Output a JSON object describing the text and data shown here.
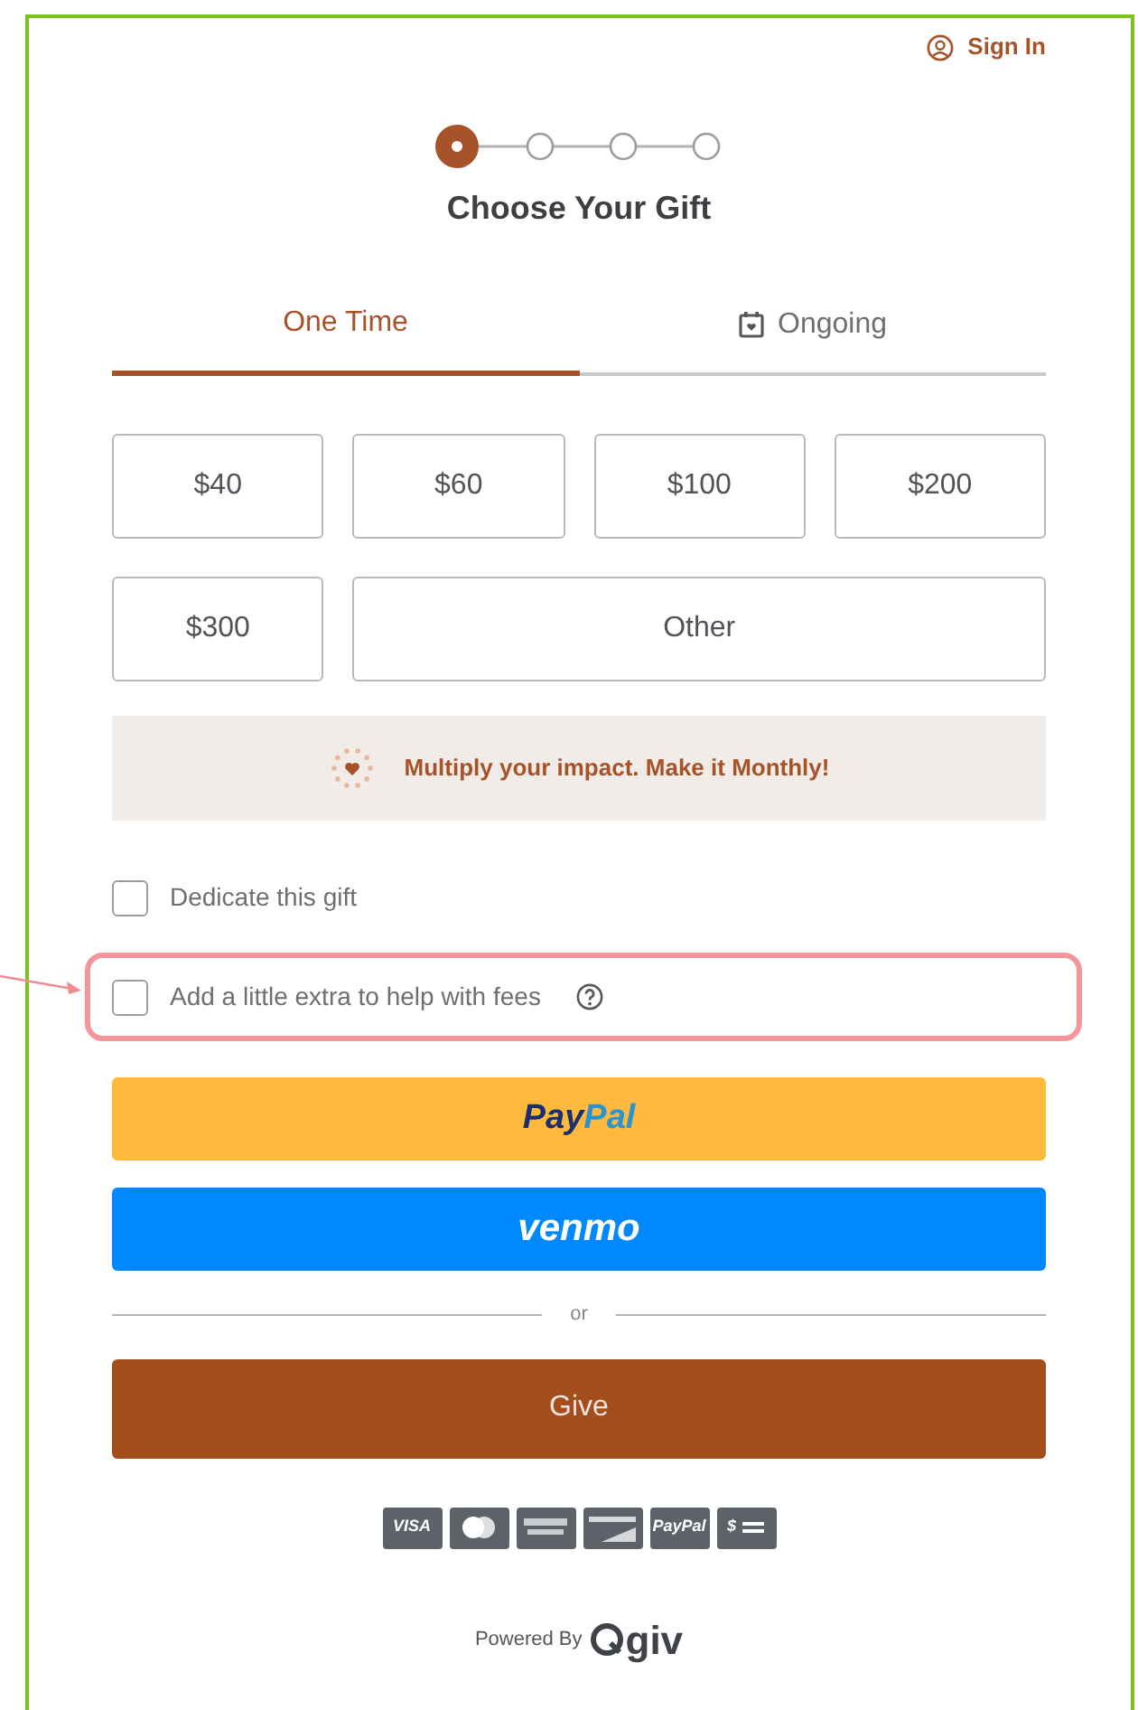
{
  "sign_in": {
    "label": "Sign In"
  },
  "stepper": {
    "steps": [
      {
        "selected": true
      },
      {
        "selected": false
      },
      {
        "selected": false
      },
      {
        "selected": false
      }
    ]
  },
  "title": "Choose Your Gift",
  "tabs": [
    {
      "label": "One Time",
      "selected": true,
      "kind": "plain"
    },
    {
      "label": "Ongoing",
      "selected": false,
      "kind": "calendar"
    }
  ],
  "amounts": [
    {
      "label": "$40",
      "selected": false
    },
    {
      "label": "$60",
      "selected": false
    },
    {
      "label": "$100",
      "selected": false
    },
    {
      "label": "$200",
      "selected": false
    },
    {
      "label": "$300",
      "selected": false
    },
    {
      "label": "Other",
      "selected": false
    }
  ],
  "banner": {
    "text": "Multiply your impact. Make it Monthly!"
  },
  "options": [
    {
      "label": "Dedicate this gift",
      "checked": false,
      "help": false,
      "highlighted": false
    },
    {
      "label": "Add a little extra to help with fees",
      "checked": false,
      "help": true,
      "highlighted": true
    }
  ],
  "paypal": {
    "parts": [
      "Pay",
      "Pal"
    ]
  },
  "venmo": {
    "label": "venmo"
  },
  "divider": {
    "label": "or"
  },
  "give": {
    "label": "Give"
  },
  "cards": [
    {
      "kind": "visa",
      "label": "VISA"
    },
    {
      "kind": "mastercard"
    },
    {
      "kind": "amex"
    },
    {
      "kind": "discover"
    },
    {
      "kind": "paypal",
      "label": "PayPal"
    },
    {
      "kind": "ach",
      "label": "$"
    }
  ],
  "powered": {
    "label": "Powered By",
    "logo": "giv"
  }
}
